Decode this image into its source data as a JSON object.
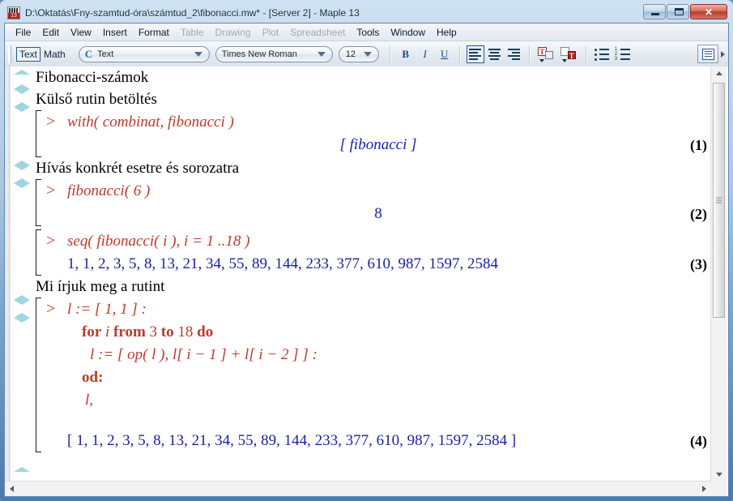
{
  "window": {
    "title": "D:\\Oktatás\\Fny-szamtud-óra\\számtud_2\\fibonacci.mw* - [Server 2] - Maple 13",
    "app_icon": "maple-icon",
    "buttons": {
      "minimize": "minimize",
      "maximize": "maximize",
      "close": "✕"
    }
  },
  "menubar": {
    "items": [
      {
        "label": "File",
        "disabled": false
      },
      {
        "label": "Edit",
        "disabled": false
      },
      {
        "label": "View",
        "disabled": false
      },
      {
        "label": "Insert",
        "disabled": false
      },
      {
        "label": "Format",
        "disabled": false
      },
      {
        "label": "Table",
        "disabled": true
      },
      {
        "label": "Drawing",
        "disabled": true
      },
      {
        "label": "Plot",
        "disabled": true
      },
      {
        "label": "Spreadsheet",
        "disabled": true
      },
      {
        "label": "Tools",
        "disabled": false
      },
      {
        "label": "Window",
        "disabled": false
      },
      {
        "label": "Help",
        "disabled": false
      }
    ]
  },
  "toolbar": {
    "mode_text": "Text",
    "mode_math": "Math",
    "style_icon": "C",
    "style_value": "Text",
    "font_value": "Times New Roman",
    "size_value": "12",
    "bold": "B",
    "italic": "I",
    "underline": "U",
    "align_left": "align-left",
    "align_center": "align-center",
    "align_right": "align-right",
    "text_color": "T",
    "highlight_color": "T",
    "bullet_list": "bullet-list",
    "numbered_list": "numbered-list",
    "num1": "1",
    "num2": "2",
    "num3": "3",
    "panel_toggle": "panel-toggle"
  },
  "document": {
    "heading1": "Fibonacci-számok",
    "heading2": "Külső rutin betöltés",
    "heading3": "Hívás konkrét esetre és sorozatra",
    "heading4": "Mi írjuk meg a rutint",
    "prompt": ">",
    "group1": {
      "input": "with( combinat, fibonacci )",
      "output": "[ fibonacci ]",
      "label": "(1)"
    },
    "group2": {
      "input": "fibonacci( 6 )",
      "output": "8",
      "label": "(2)"
    },
    "group3": {
      "input": "seq( fibonacci( i ), i = 1 ..18 )",
      "output": "1, 1, 2, 3, 5, 8, 13, 21, 34, 55, 89, 144, 233, 377, 610, 987, 1597, 2584",
      "label": "(3)"
    },
    "group4": {
      "line1": "l :=  [ 1, 1 ] :",
      "line2_kw1": "for",
      "line2_var": "i",
      "line2_kw2": "from",
      "line2_n1": "3",
      "line2_kw3": "to",
      "line2_n2": "18",
      "line2_kw4": "do",
      "line3": "l :=  [ op( l ), l[ i − 1 ] + l[ i − 2 ] ] :",
      "line4": "od:",
      "line5": "l,",
      "output": "[ 1, 1, 2, 3, 5, 8, 13, 21, 34, 55, 89, 144, 233, 377, 610, 987, 1597, 2584 ]",
      "label": "(4)"
    }
  },
  "scrollbars": {
    "v_up": "scroll-up",
    "v_down": "scroll-down",
    "h_left": "scroll-left",
    "h_right": "scroll-right"
  },
  "colors": {
    "input_red": "#c0392b",
    "output_blue": "#1b22a8",
    "marker_teal": "#9fd6e2",
    "titlebar_blue": "#4b79aa"
  }
}
